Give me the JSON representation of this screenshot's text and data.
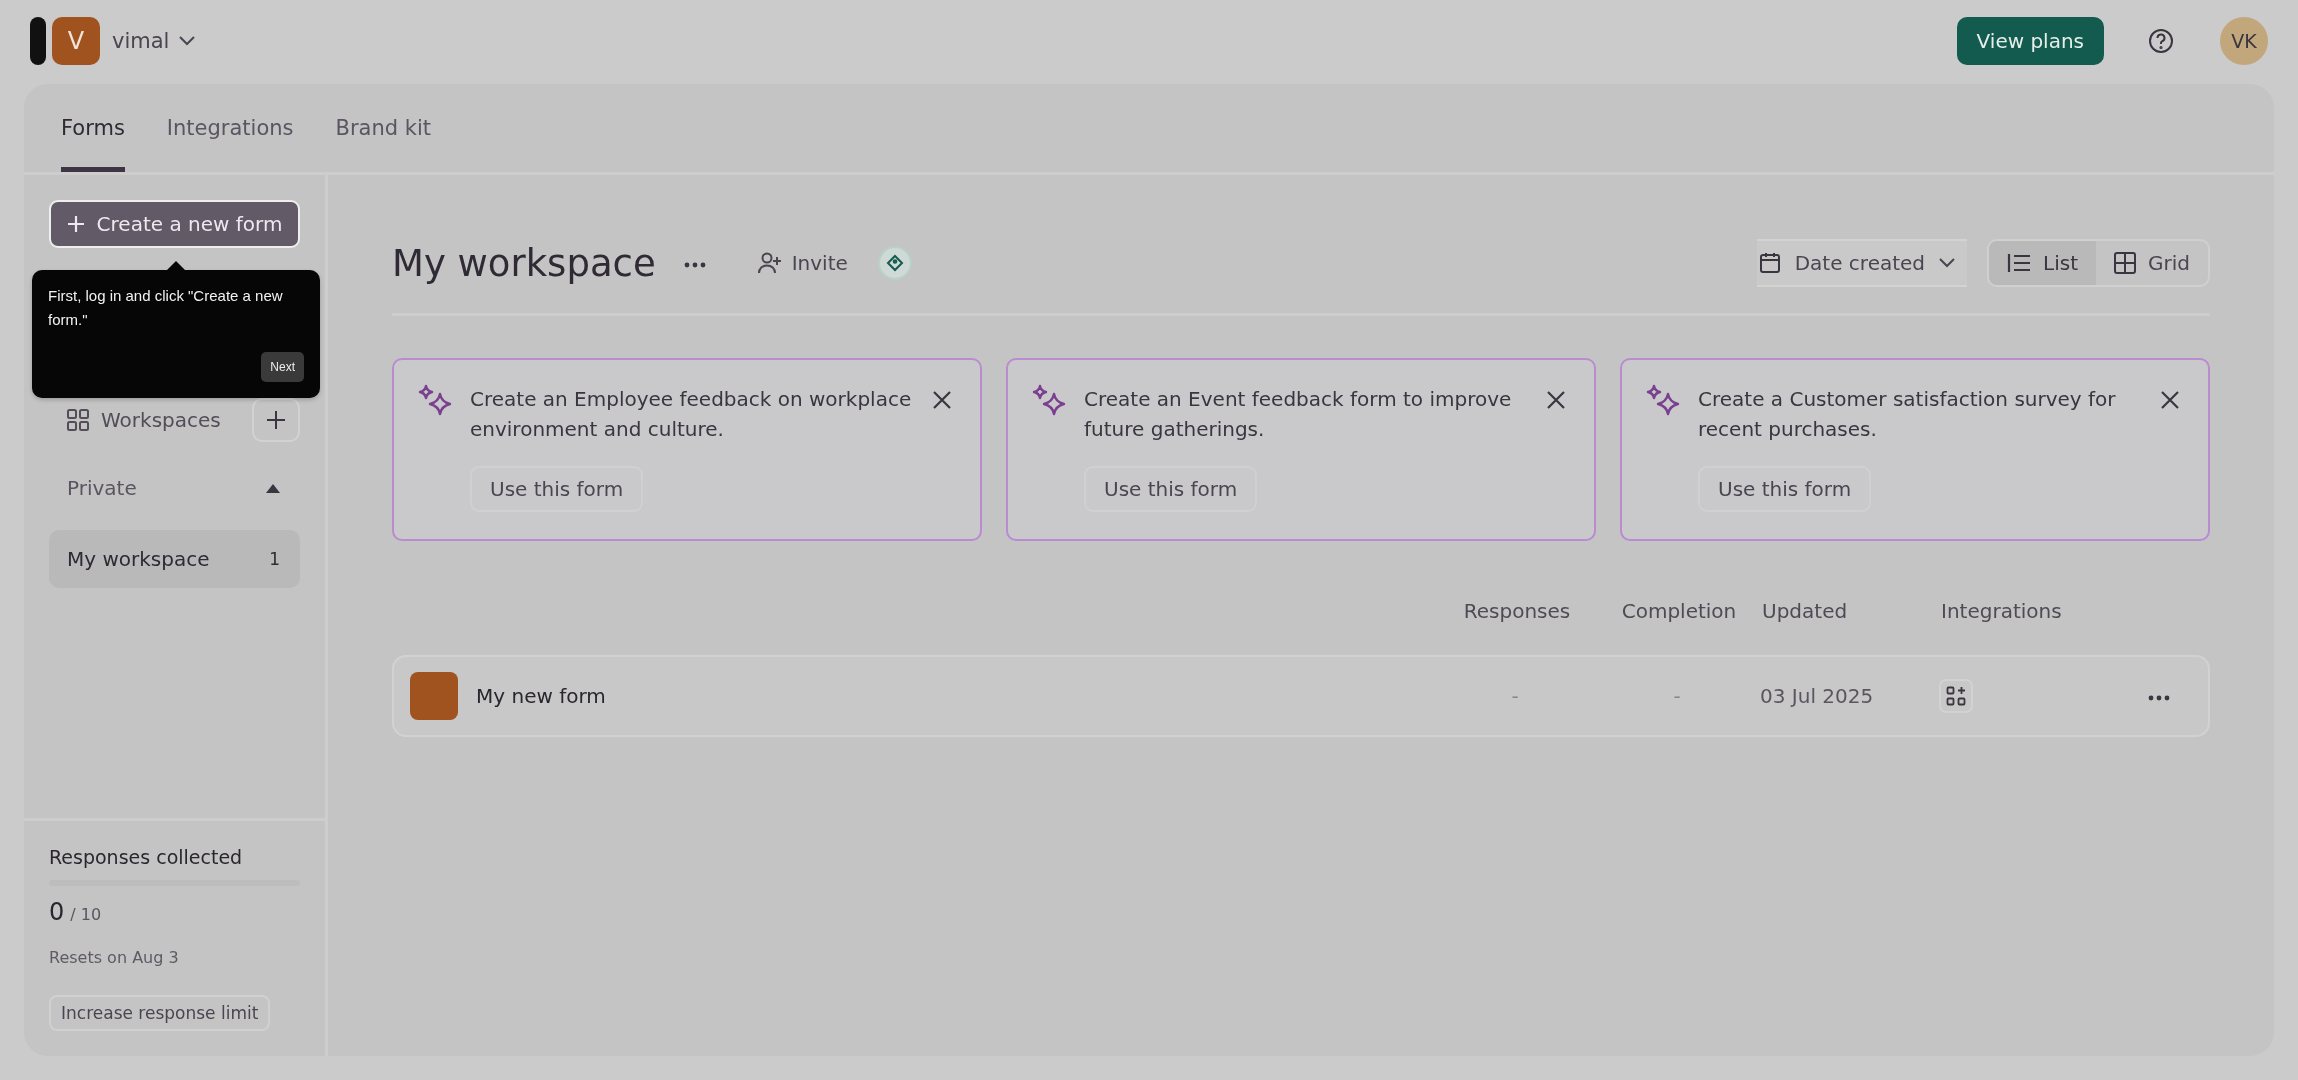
{
  "header": {
    "workspace_initial": "V",
    "workspace_name": "vimal",
    "view_plans": "View plans",
    "avatar": "VK"
  },
  "tabs": [
    {
      "label": "Forms",
      "selected": true
    },
    {
      "label": "Integrations",
      "selected": false
    },
    {
      "label": "Brand kit",
      "selected": false
    }
  ],
  "sidebar": {
    "create_button": "Create a new form",
    "tooltip": {
      "text": "First, log in and click \"Create a new form.\"",
      "button": "Next"
    },
    "workspaces_label": "Workspaces",
    "section": {
      "label": "Private",
      "expanded": true
    },
    "items": [
      {
        "label": "My workspace",
        "count": "1",
        "selected": true
      }
    ],
    "usage": {
      "title": "Responses collected",
      "level": 0,
      "count": "0",
      "limit": "/ 10",
      "resets": "Resets on Aug 3",
      "button": "Increase response limit"
    }
  },
  "main": {
    "title": "My workspace",
    "invite": "Invite",
    "sort": "Date created",
    "views": [
      {
        "label": "List",
        "selected": true
      },
      {
        "label": "Grid",
        "selected": false
      }
    ],
    "suggestions": [
      {
        "text": "Create an Employee feedback on workplace environment and culture.",
        "button": "Use this form"
      },
      {
        "text": "Create an Event feedback form to improve future gatherings.",
        "button": "Use this form"
      },
      {
        "text": "Create a Customer satisfaction survey for recent purchases.",
        "button": "Use this form"
      }
    ],
    "table": {
      "columns": [
        "Responses",
        "Completion",
        "Updated",
        "Integrations"
      ],
      "rows": [
        {
          "name": "My new form",
          "responses": "-",
          "completion": "-",
          "updated": "03 Jul 2025"
        }
      ]
    }
  }
}
